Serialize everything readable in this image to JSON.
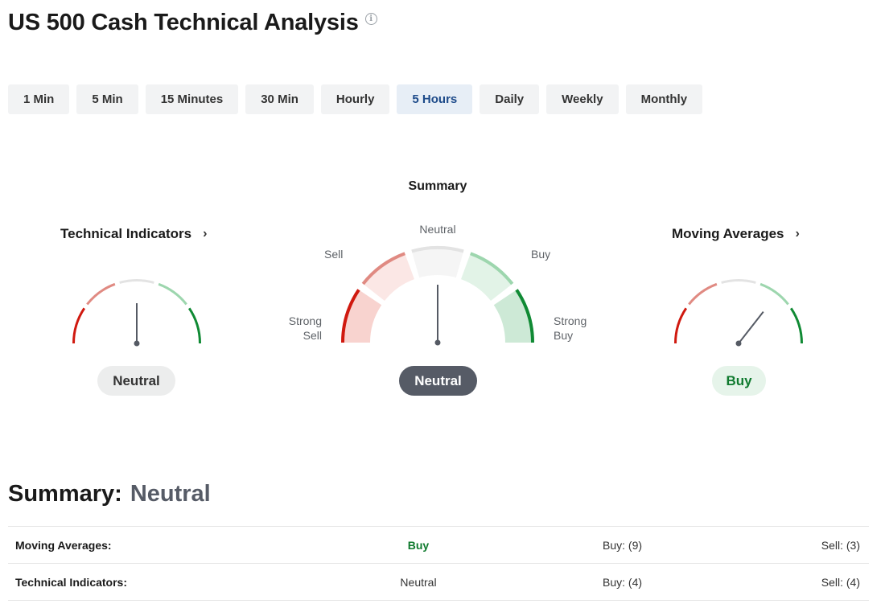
{
  "header": {
    "title": "US 500 Cash Technical Analysis",
    "info_icon": "info-icon"
  },
  "tabs": [
    {
      "label": "1 Min",
      "active": false
    },
    {
      "label": "5 Min",
      "active": false
    },
    {
      "label": "15 Minutes",
      "active": false
    },
    {
      "label": "30 Min",
      "active": false
    },
    {
      "label": "Hourly",
      "active": false
    },
    {
      "label": "5 Hours",
      "active": true
    },
    {
      "label": "Daily",
      "active": false
    },
    {
      "label": "Weekly",
      "active": false
    },
    {
      "label": "Monthly",
      "active": false
    }
  ],
  "gauges": {
    "summary_heading": "Summary",
    "technical_indicators": {
      "title": "Technical Indicators",
      "signal": "Neutral"
    },
    "summary": {
      "signal": "Neutral",
      "labels": {
        "strong_sell": "Strong Sell",
        "sell": "Sell",
        "neutral": "Neutral",
        "buy": "Buy",
        "strong_buy": "Strong Buy"
      }
    },
    "moving_averages": {
      "title": "Moving Averages",
      "signal": "Buy"
    }
  },
  "summary_line": {
    "label": "Summary:",
    "value": "Neutral"
  },
  "table": {
    "rows": [
      {
        "name": "Moving Averages:",
        "signal": "Buy",
        "buy": "Buy: (9)",
        "sell": "Sell: (3)"
      },
      {
        "name": "Technical Indicators:",
        "signal": "Neutral",
        "buy": "Buy: (4)",
        "sell": "Sell: (4)"
      }
    ]
  },
  "colors": {
    "strong_sell": "#d0190f",
    "sell": "#e08a82",
    "neutral": "#e3e3e3",
    "buy": "#9dd6ae",
    "strong_buy": "#108a34",
    "buy_text": "#0f7a2e",
    "active_tab_bg": "#e7eef6",
    "active_tab_text": "#1e4b8a",
    "dark_pill": "#565b66"
  }
}
